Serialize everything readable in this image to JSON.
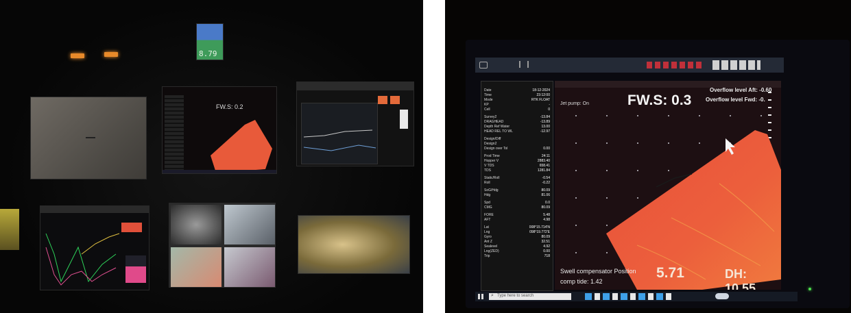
{
  "left_photo": {
    "small_screen_reading": "8.79",
    "monitor_fws_label": "FW.S: 0.2"
  },
  "right_photo": {
    "fws_label": "FW.S: 0.3",
    "overflow_aft": "Overflow level Aft: -0.60",
    "overflow_fwd": "Overflow level Fwd: -0.",
    "jet_pump": "Jet pump: On",
    "swell_text": "Swell compensator Position",
    "tide_text": "comp tide: 1.42",
    "big_value": "5.71",
    "dh_text": "DH: 10.55",
    "taskbar_search": "Type here to search",
    "left_panel_rows": [
      {
        "label": "Date",
        "value": "18-12-2024"
      },
      {
        "label": "Time",
        "value": "23:12:00"
      },
      {
        "label": "Mode",
        "value": "RTK FLOAT"
      },
      {
        "label": "KP",
        "value": "-"
      },
      {
        "label": "Cell",
        "value": "0"
      },
      {
        "label": "Survey2",
        "value": "-13.84"
      },
      {
        "label": "DRAGHEAD",
        "value": "-13.89"
      },
      {
        "label": "Depth Ref Water",
        "value": "13.00"
      },
      {
        "label": "HEAD REL TO WL",
        "value": "-12.97"
      },
      {
        "label": "Design/Diff",
        "value": ""
      },
      {
        "label": "Design2",
        "value": ""
      },
      {
        "label": "Design over Tol",
        "value": "0.00"
      },
      {
        "label": "Prod Time",
        "value": "24:11"
      },
      {
        "label": "Hopper V",
        "value": "2883.40"
      },
      {
        "label": "V TDS",
        "value": "658.41"
      },
      {
        "label": "TDS",
        "value": "1281.84"
      },
      {
        "label": "Static/Roll",
        "value": "-0.54"
      },
      {
        "label": "Roll",
        "value": "-0.22"
      },
      {
        "label": "SoG/Hdg",
        "value": "80.09"
      },
      {
        "label": "Hdg",
        "value": "81.06"
      },
      {
        "label": "Spd",
        "value": "0.0"
      },
      {
        "label": "CMG",
        "value": "80.09"
      },
      {
        "label": "FORE",
        "value": "5.48"
      },
      {
        "label": "AFT",
        "value": "4.98"
      },
      {
        "label": "Lat",
        "value": "008°15.714'N"
      },
      {
        "label": "Lng",
        "value": "098°19.772'E"
      },
      {
        "label": "Gyro",
        "value": "80.09"
      },
      {
        "label": "Ant Z",
        "value": "32.51"
      },
      {
        "label": "Sealevel",
        "value": "4.92"
      },
      {
        "label": "Lng(ZED)",
        "value": "0.00"
      },
      {
        "label": "Trip",
        "value": "718"
      }
    ]
  },
  "colors": {
    "swath_red": "#e8503a",
    "dark_bg": "#050403",
    "display_bg": "#1d0f12"
  }
}
